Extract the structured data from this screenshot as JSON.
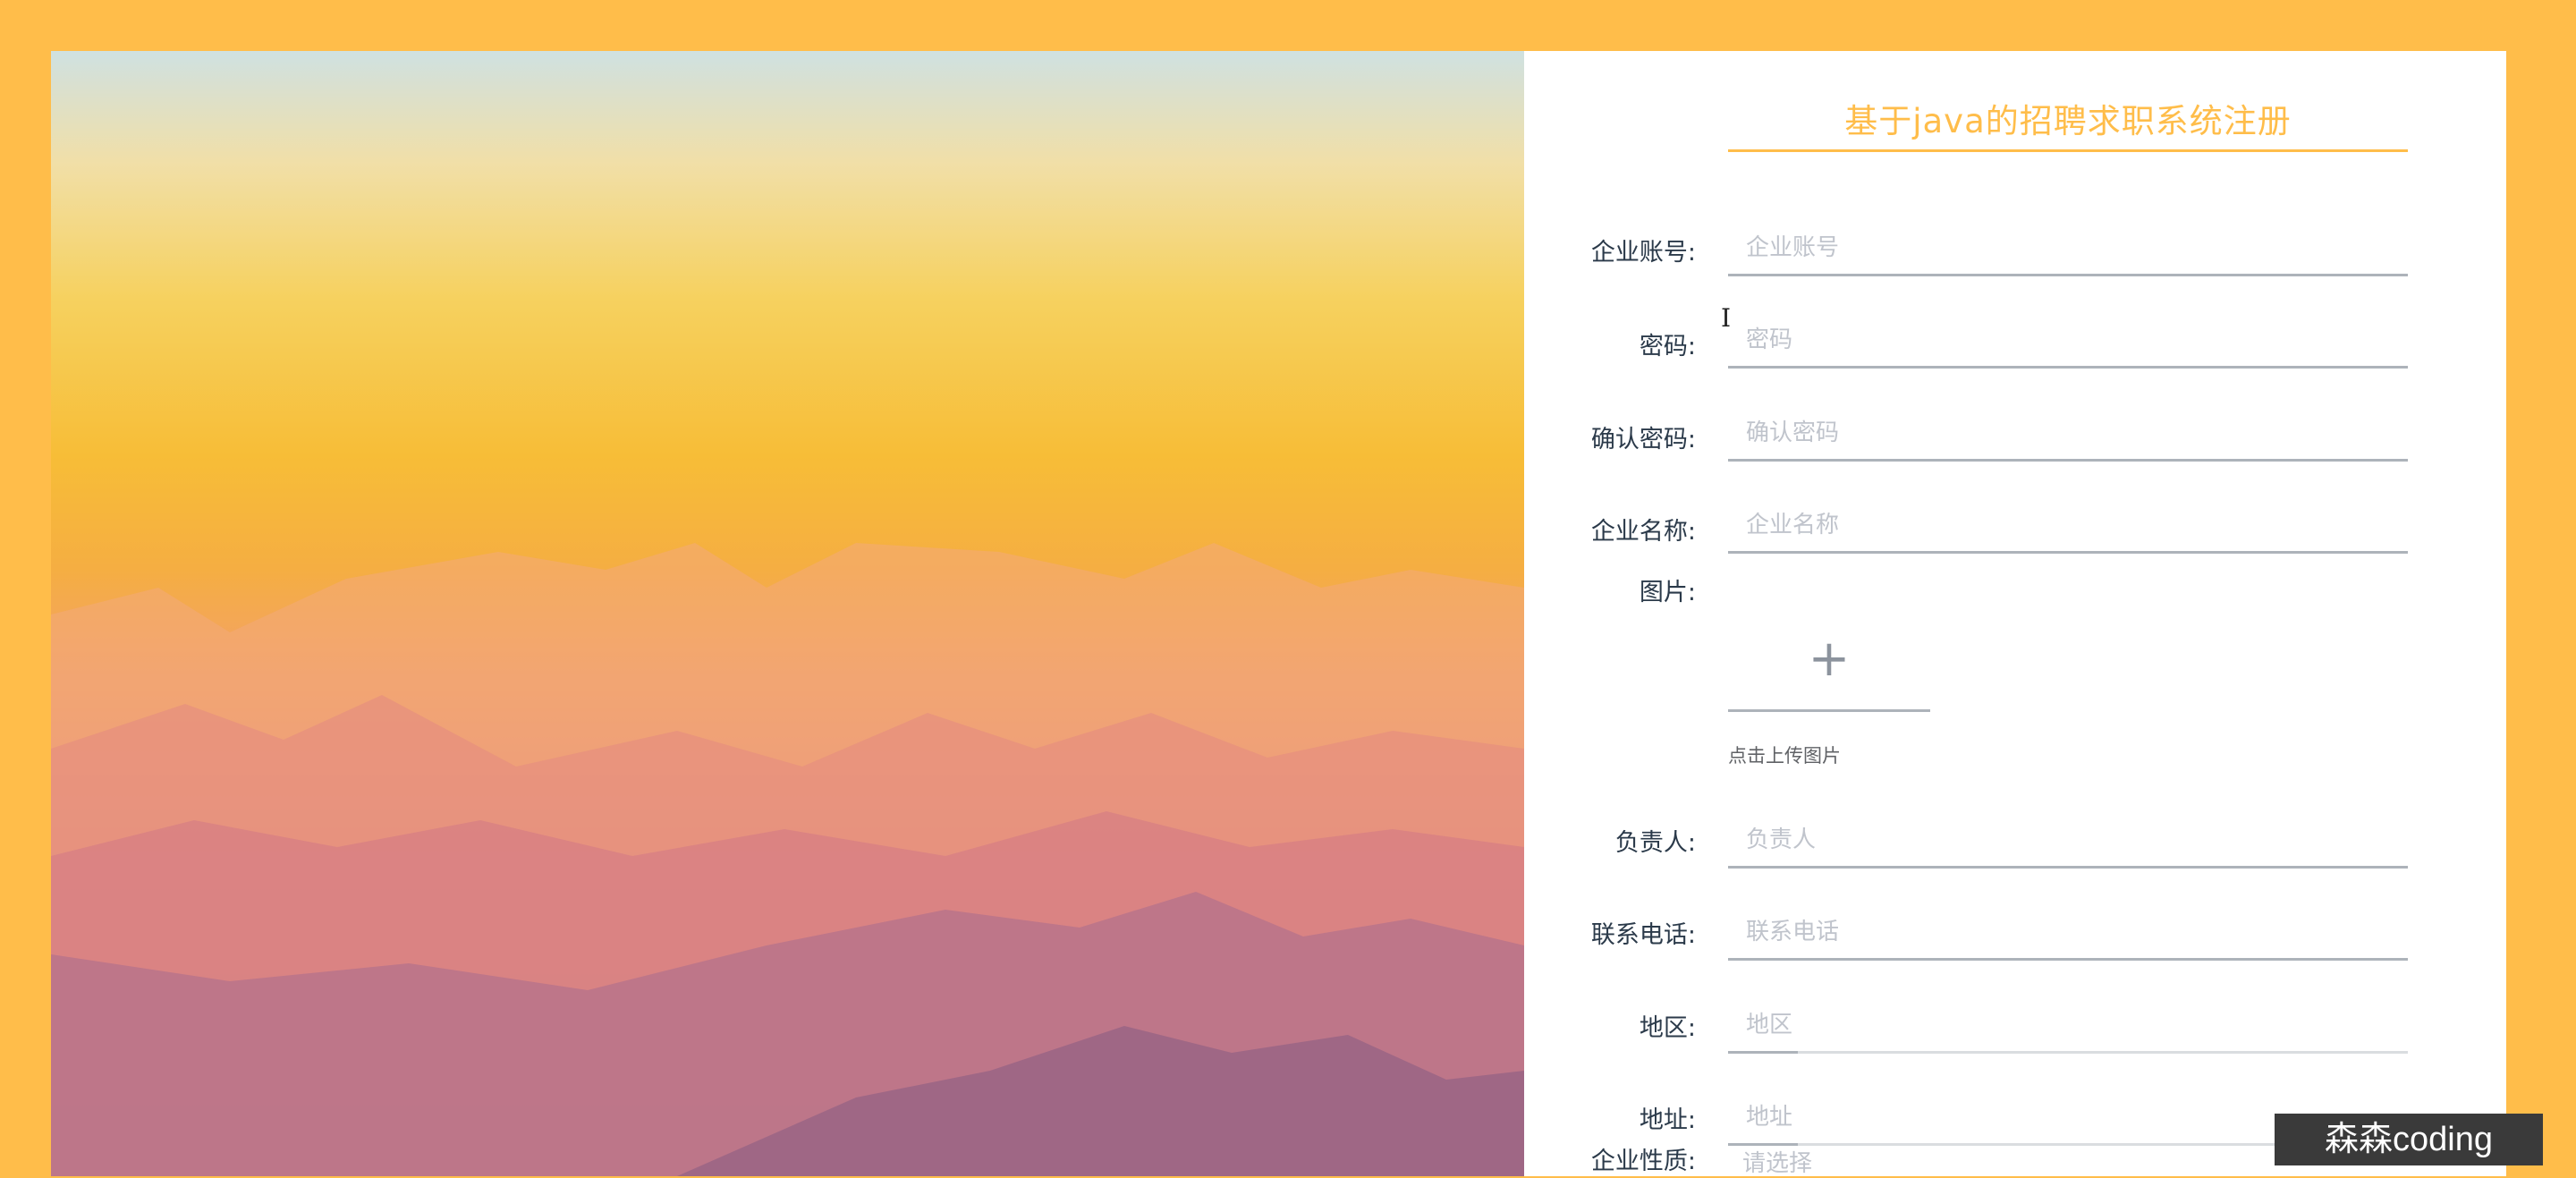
{
  "form": {
    "title": "基于java的招聘求职系统注册",
    "fields": [
      {
        "label": "企业账号:",
        "placeholder": "企业账号"
      },
      {
        "label": "密码:",
        "placeholder": "密码"
      },
      {
        "label": "确认密码:",
        "placeholder": "确认密码"
      },
      {
        "label": "企业名称:",
        "placeholder": "企业名称"
      },
      {
        "label": "负责人:",
        "placeholder": "负责人"
      },
      {
        "label": "联系电话:",
        "placeholder": "联系电话"
      },
      {
        "label": "地区:",
        "placeholder": "地区"
      },
      {
        "label": "地址:",
        "placeholder": "地址"
      }
    ],
    "image": {
      "label": "图片:",
      "plus": "+",
      "hint": "点击上传图片"
    },
    "nature": {
      "label": "企业性质:",
      "placeholder": "请选择"
    }
  },
  "watermark": "森森coding",
  "colors": {
    "accent": "#ffbd4a",
    "border": "#adb3ba"
  },
  "hero": {
    "description": "sunset-mountains-background"
  }
}
